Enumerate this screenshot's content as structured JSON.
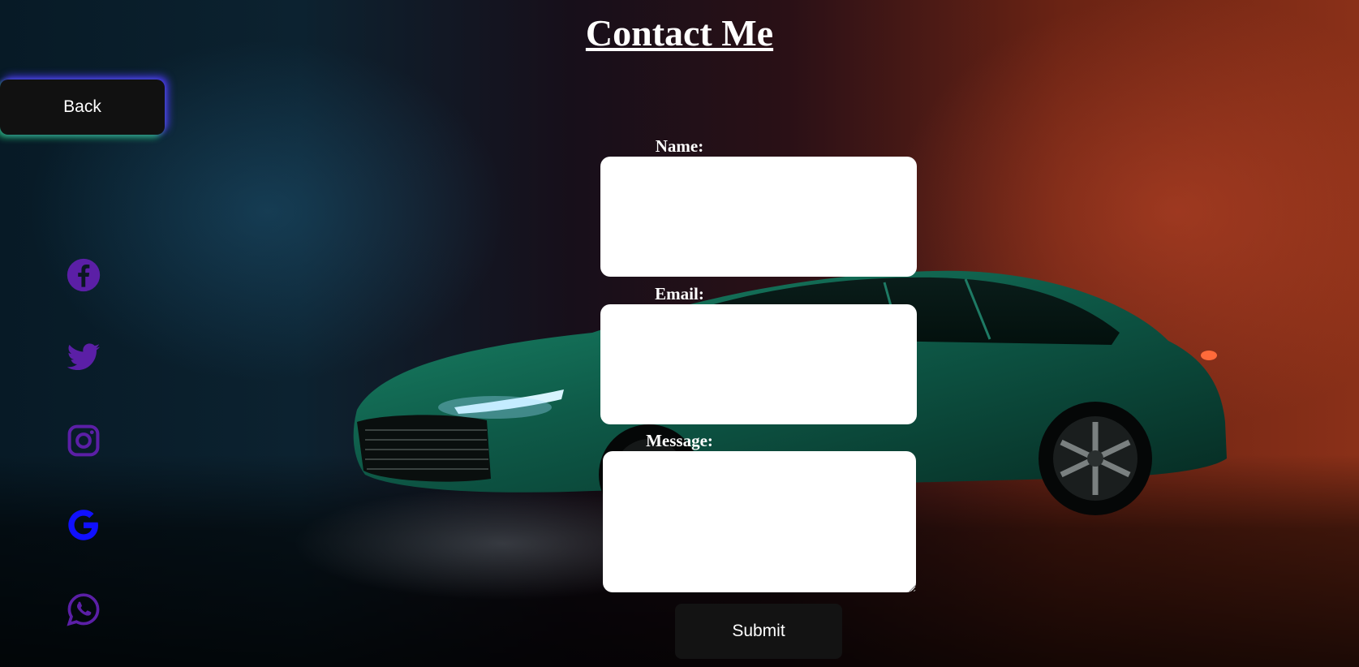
{
  "title": "Contact Me",
  "back_button": {
    "label": "Back"
  },
  "social_links": [
    {
      "name": "facebook-icon",
      "color": "#5b1fa6"
    },
    {
      "name": "twitter-icon",
      "color": "#5b1fa6"
    },
    {
      "name": "instagram-icon",
      "color": "#5b1fa6"
    },
    {
      "name": "google-icon",
      "color": "#1010ff"
    },
    {
      "name": "whatsapp-icon",
      "color": "#5b1fa6"
    }
  ],
  "form": {
    "name_label": "Name:",
    "name_value": "",
    "email_label": "Email:",
    "email_value": "",
    "message_label": "Message:",
    "message_value": "",
    "submit_label": "Submit"
  },
  "colors": {
    "button_bg": "#111111",
    "text": "#ffffff",
    "field_bg": "#ffffff",
    "back_glow_left": "#28c878",
    "back_glow_right": "#503cff"
  }
}
